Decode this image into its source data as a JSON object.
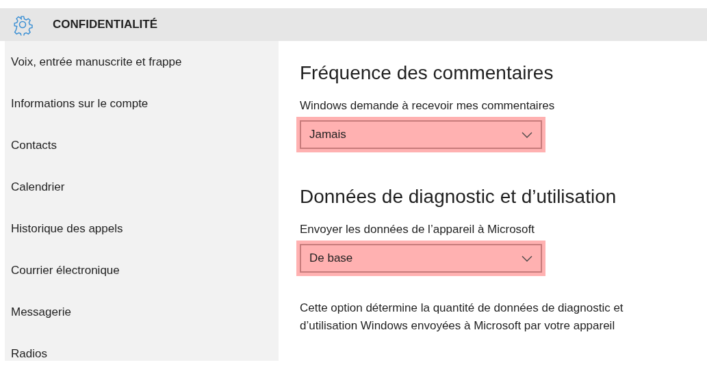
{
  "header": {
    "title": "CONFIDENTIALITÉ"
  },
  "sidebar": {
    "items": [
      {
        "label": "Voix, entrée manuscrite et frappe",
        "selected": false
      },
      {
        "label": "Informations sur le compte",
        "selected": false
      },
      {
        "label": "Contacts",
        "selected": false
      },
      {
        "label": "Calendrier",
        "selected": false
      },
      {
        "label": "Historique des appels",
        "selected": false
      },
      {
        "label": "Courrier électronique",
        "selected": false
      },
      {
        "label": "Messagerie",
        "selected": false
      },
      {
        "label": "Radios",
        "selected": false
      }
    ]
  },
  "sections": [
    {
      "heading": "Fréquence des commentaires",
      "label": "Windows demande à recevoir mes commentaires",
      "dropdown": {
        "value": "Jamais",
        "highlighted": true
      }
    },
    {
      "heading": "Données de diagnostic et d’utilisation",
      "label": "Envoyer les données de l’appareil à Microsoft",
      "dropdown": {
        "value": "De base",
        "highlighted": true
      },
      "description": "Cette option détermine la quantité de données de diagnostic et d’utilisation Windows envoyées à Microsoft par votre appareil"
    }
  ]
}
